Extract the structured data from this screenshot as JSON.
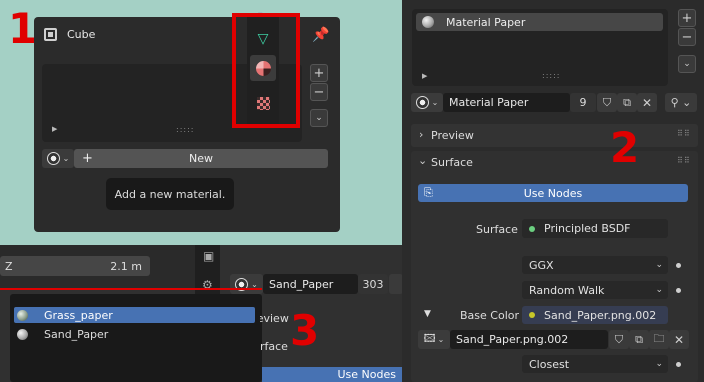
{
  "annotations": {
    "n1": "1",
    "n2": "2",
    "n3": "3"
  },
  "popup": {
    "object_name": "Cube",
    "new_label": "New",
    "tooltip": "Add a new material."
  },
  "lower_left": {
    "z_label": "Z",
    "z_value": "2.1 m",
    "material_field": "Sand_Paper",
    "user_count": "303",
    "list": [
      {
        "name": "Grass_paper",
        "selected": true
      },
      {
        "name": "Sand_Paper",
        "selected": false
      }
    ],
    "preview_label": "Preview",
    "surface_label": "Surface",
    "use_nodes_label": "Use Nodes"
  },
  "right_panel": {
    "slot_item": "Material Paper",
    "material_field": "Material Paper",
    "user_count": "9",
    "preview_label": "Preview",
    "surface_label": "Surface",
    "use_nodes_label": "Use Nodes",
    "surface_prop_label": "Surface",
    "surface_shader": "Principled BSDF",
    "distribution": "GGX",
    "subsurface": "Random Walk",
    "base_color_label": "Base Color",
    "base_color_value": "Sand_Paper.png.002",
    "image_field": "Sand_Paper.png.002",
    "interpolation": "Closest"
  },
  "colors": {
    "annotation_red": "#e00000",
    "accent_blue": "#4772b3",
    "shader_green": "#6bcf80",
    "socket_yellow": "#c7c729"
  }
}
